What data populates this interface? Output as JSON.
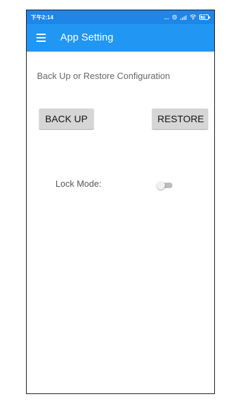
{
  "status_bar": {
    "time": "下午2:14",
    "more": "...",
    "battery": "58",
    "icons": [
      "alarm-icon",
      "signal-icon",
      "wifi-icon",
      "battery-icon"
    ]
  },
  "app_bar": {
    "title": "App Setting",
    "menu_icon": "menu-icon"
  },
  "backup_restore": {
    "label": "Back Up or Restore Configuration",
    "backup_button": "BACK UP",
    "restore_button": "RESTORE"
  },
  "lock_mode": {
    "label": "Lock Mode:",
    "enabled": false
  },
  "colors": {
    "status_bar": "#1f86e8",
    "app_bar": "#2196f3",
    "button": "#d6d6d6",
    "text_muted": "#666666"
  }
}
